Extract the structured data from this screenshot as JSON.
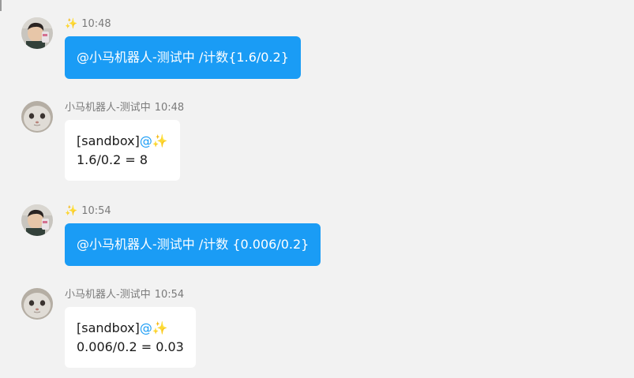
{
  "messages": [
    {
      "direction": "out",
      "sender": "✨",
      "time": "10:48",
      "text": "@小马机器人-测试中 /计数{1.6/0.2}"
    },
    {
      "direction": "in",
      "sender": "小马机器人-测试中",
      "time": "10:48",
      "tag": "[sandbox]",
      "mention": "@",
      "mention_emoji": "✨",
      "result": "1.6/0.2 = 8"
    },
    {
      "direction": "out",
      "sender": "✨",
      "time": "10:54",
      "text": "@小马机器人-测试中 /计数 {0.006/0.2}"
    },
    {
      "direction": "in",
      "sender": "小马机器人-测试中",
      "time": "10:54",
      "tag": "[sandbox]",
      "mention": "@",
      "mention_emoji": "✨",
      "result": "0.006/0.2 = 0.03"
    }
  ],
  "colors": {
    "background": "#f2f2f2",
    "outgoing_bubble": "#1a9cf5",
    "incoming_bubble": "#ffffff",
    "mention": "#1a9cf5",
    "meta_text": "#7a7a7a"
  },
  "avatars": {
    "user": "child-photo-avatar",
    "bot": "cat-photo-avatar"
  }
}
